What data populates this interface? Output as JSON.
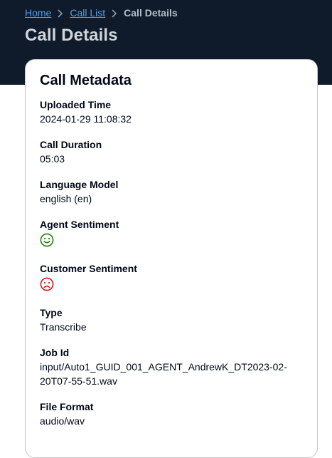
{
  "breadcrumb": {
    "items": [
      {
        "label": "Home"
      },
      {
        "label": "Call List"
      }
    ],
    "current": "Call Details"
  },
  "page": {
    "title": "Call Details"
  },
  "card": {
    "title": "Call Metadata",
    "fields": [
      {
        "label": "Uploaded Time",
        "value": "2024-01-29 11:08:32"
      },
      {
        "label": "Call Duration",
        "value": "05:03"
      },
      {
        "label": "Language Model",
        "value": "english (en)"
      },
      {
        "label": "Agent Sentiment",
        "icon": "smile-icon",
        "color": "#1d8102"
      },
      {
        "label": "Customer Sentiment",
        "icon": "frown-icon",
        "color": "#d91515"
      },
      {
        "label": "Type",
        "value": "Transcribe"
      },
      {
        "label": "Job Id",
        "value_line1": "input/Auto1_GUID_001_AGENT_AndrewK_DT2023-02-",
        "value_line2": "20T07-55-51.wav"
      },
      {
        "label": "File Format",
        "value": "audio/wav"
      }
    ]
  },
  "colors": {
    "header_bg": "#0f1b2a",
    "link": "#539fe5",
    "positive": "#1d8102",
    "negative": "#d91515"
  }
}
